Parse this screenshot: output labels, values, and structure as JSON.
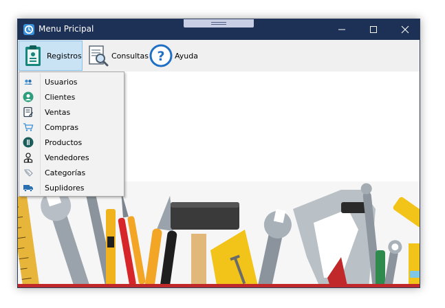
{
  "window": {
    "title": "Menu Pricipal",
    "controls": {
      "minimize": "minimize",
      "maximize": "maximize",
      "close": "close"
    }
  },
  "menubar": {
    "items": [
      {
        "label": "Registros",
        "icon": "clipboard-icon",
        "active": true
      },
      {
        "label": "Consultas",
        "icon": "search-document-icon",
        "active": false
      },
      {
        "label": "Ayuda",
        "icon": "help-icon",
        "active": false
      }
    ]
  },
  "registros_menu": {
    "items": [
      {
        "label": "Usuarios",
        "icon": "users-icon"
      },
      {
        "label": "Clientes",
        "icon": "client-icon"
      },
      {
        "label": "Ventas",
        "icon": "sales-icon"
      },
      {
        "label": "Compras",
        "icon": "cart-icon"
      },
      {
        "label": "Productos",
        "icon": "products-icon"
      },
      {
        "label": "Vendedores",
        "icon": "seller-icon"
      },
      {
        "label": "Categorías",
        "icon": "category-icon"
      },
      {
        "label": "Suplidores",
        "icon": "truck-icon"
      }
    ]
  },
  "colors": {
    "titlebar": "#1d3055",
    "menubar": "#f0f0f0",
    "active_menu": "#c9e3f5",
    "dropdown": "#f2f2f2",
    "bottom_stripe": "#c0282a"
  },
  "background_image": "tools-banner"
}
